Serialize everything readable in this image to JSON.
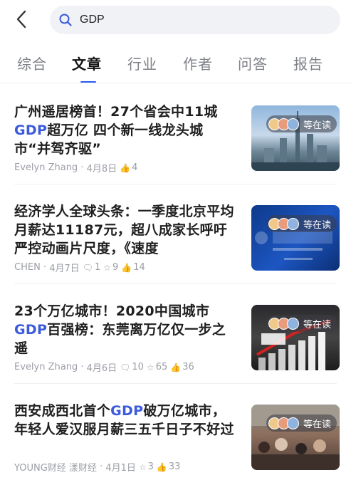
{
  "search": {
    "query": "GDP"
  },
  "tabs": [
    {
      "label": "综合"
    },
    {
      "label": "文章"
    },
    {
      "label": "行业"
    },
    {
      "label": "作者"
    },
    {
      "label": "问答"
    },
    {
      "label": "报告"
    }
  ],
  "active_tab": "文章",
  "accent_color": "#2b5cf6",
  "highlight_color": "#3b5bdb",
  "articles": [
    {
      "title_parts": [
        "广州遥居榜首！27个省会中11城",
        "GDP",
        "超万亿 四个新一线龙头城市“并驾齐驱”"
      ],
      "author": "Evelyn Zhang",
      "date": "4月8日",
      "likes": "4",
      "badge": "等在读"
    },
    {
      "title_parts": [
        "经济学人全球头条：一季度北京平均月薪达11187元，超八成家长呼吁严控动画片尺度，《速度"
      ],
      "author": "CHEN",
      "date": "4月7日",
      "comments": "1",
      "stars": "9",
      "likes": "14",
      "badge": "等在读"
    },
    {
      "title_parts": [
        "23个万亿城市！2020中国城市",
        "GDP",
        "百强榜：东莞离万亿仅一步之遥"
      ],
      "author": "Evelyn Zhang",
      "date": "4月6日",
      "comments": "10",
      "stars": "65",
      "likes": "36",
      "badge": "等在读"
    },
    {
      "title_parts": [
        "西安成西北首个",
        "GDP",
        "破万亿城市，年轻人爱汉服月薪三五千日子不好过"
      ],
      "author": "YOUNG财经 漾财经",
      "date": "4月1日",
      "stars": "3",
      "likes": "33",
      "badge": "等在读"
    }
  ]
}
